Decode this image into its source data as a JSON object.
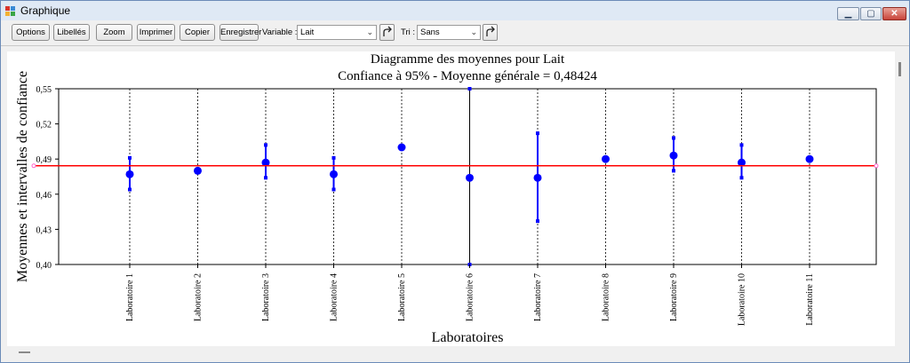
{
  "window": {
    "title": "Graphique"
  },
  "controls": {
    "minimize_glyph": "▁",
    "maximize_glyph": "▢",
    "close_glyph": "✕"
  },
  "toolbar": {
    "buttons": [
      "Options",
      "Libellés",
      "Zoom",
      "Imprimer",
      "Copier",
      "Enregistrer"
    ],
    "variable_label": "Variable :",
    "variable_value": "Lait",
    "sort_label": "Tri :",
    "sort_value": "Sans"
  },
  "icons": {
    "app": "chart-icon",
    "refresh": "refresh-arrow-icon",
    "dropdown": "chevron-down-icon"
  },
  "colors": {
    "marker": "#0000ff",
    "reference_line": "#ff0000",
    "grid": "#000000"
  },
  "chart_data": {
    "type": "scatter",
    "title": "Diagramme des moyennes pour Lait",
    "subtitle": "Confiance à 95% - Moyenne générale = 0,48424",
    "xlabel": "Laboratoires",
    "ylabel": "Moyennes et intervalles de confiance",
    "ylim": [
      0.4,
      0.55
    ],
    "yticks": [
      "0,40",
      "0,43",
      "0,46",
      "0,49",
      "0,52",
      "0,55"
    ],
    "reference_line": 0.48424,
    "grid": "vertical dashed lines at each category",
    "categories": [
      "Laboratoire 1",
      "Laboratoire 2",
      "Laboratoire 3",
      "Laboratoire 4",
      "Laboratoire 5",
      "Laboratoire 6",
      "Laboratoire 7",
      "Laboratoire 8",
      "Laboratoire 9",
      "Laboratoire 10",
      "Laboratoire 11"
    ],
    "means": [
      0.477,
      0.48,
      0.487,
      0.477,
      0.5,
      0.474,
      0.474,
      0.49,
      0.493,
      0.487,
      0.49
    ],
    "ci_low": [
      0.464,
      null,
      0.474,
      0.464,
      null,
      0.4,
      0.437,
      null,
      0.48,
      0.474,
      null
    ],
    "ci_high": [
      0.491,
      null,
      0.502,
      0.491,
      null,
      0.55,
      0.512,
      null,
      0.508,
      0.502,
      null
    ]
  }
}
